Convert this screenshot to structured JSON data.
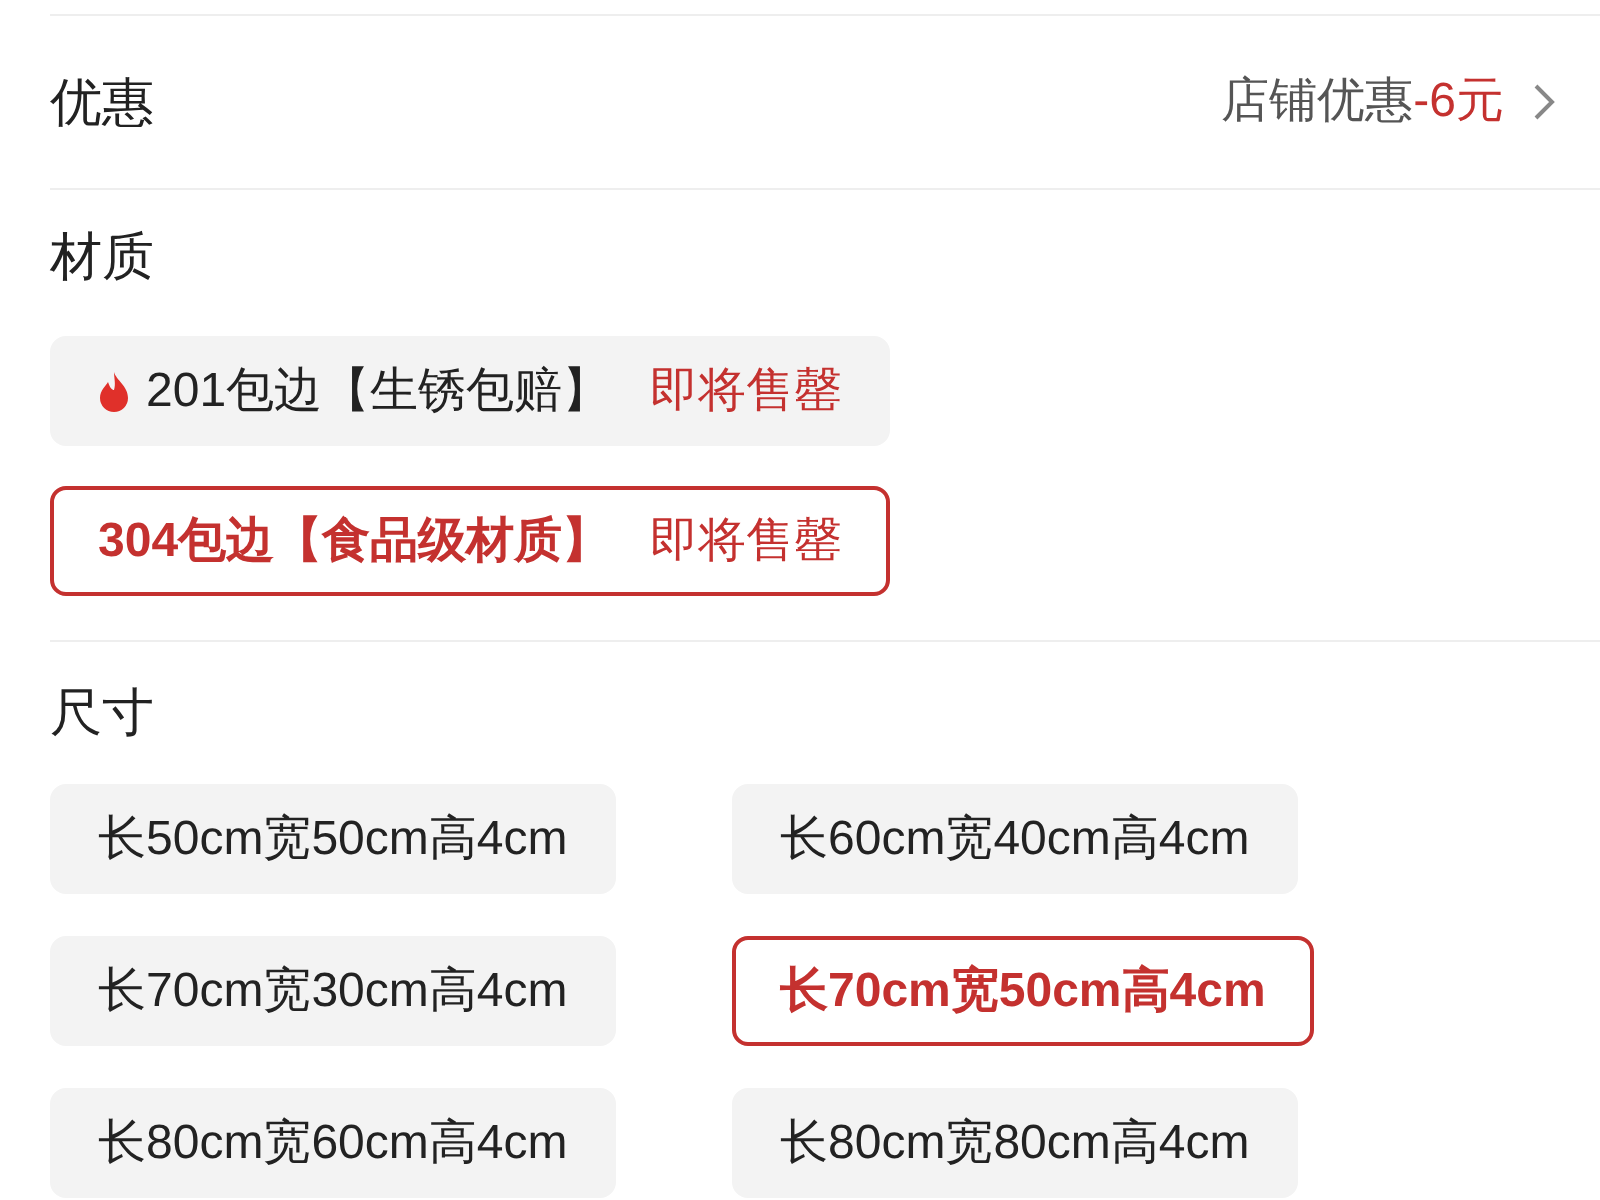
{
  "discount": {
    "label": "优惠",
    "value_label": "店铺优惠",
    "value": "-6元"
  },
  "material": {
    "label": "材质",
    "options": [
      {
        "hot": true,
        "name": "201包边【生锈包赔】",
        "tag": "即将售罄",
        "selected": false
      },
      {
        "hot": false,
        "name": "304包边【食品级材质】",
        "tag": "即将售罄",
        "selected": true
      }
    ]
  },
  "size": {
    "label": "尺寸",
    "options": [
      {
        "name": "长50cm宽50cm高4cm",
        "selected": false
      },
      {
        "name": "长60cm宽40cm高4cm",
        "selected": false
      },
      {
        "name": "长70cm宽30cm高4cm",
        "selected": false
      },
      {
        "name": "长70cm宽50cm高4cm",
        "selected": true
      },
      {
        "name": "长80cm宽60cm高4cm",
        "selected": false
      },
      {
        "name": "长80cm宽80cm高4cm",
        "selected": false
      }
    ]
  }
}
